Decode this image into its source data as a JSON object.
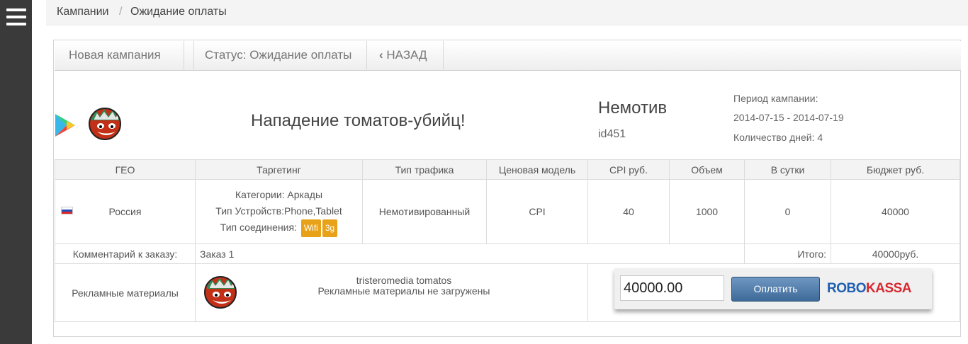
{
  "breadcrumb": {
    "root": "Кампании",
    "separator": "/",
    "current": "Ожидание оплаты"
  },
  "toolbar": {
    "new_campaign": "Новая кампания",
    "status_label": "Статус:",
    "status_value": "Ожидание оплаты",
    "back_icon": "‹",
    "back_label": "НАЗАД"
  },
  "campaign": {
    "title": "Нападение томатов-убийц!",
    "store_icon": "google-play-icon",
    "motivation": "Немотив",
    "id": "id451",
    "period_label": "Период кампании:",
    "period": "2014-07-15 - 2014-07-19",
    "days_label": "Количество дней:",
    "days": "4"
  },
  "table": {
    "headers": [
      "ГЕО",
      "Таргетинг",
      "Тип трафика",
      "Ценовая модель",
      "CPI руб.",
      "Объем",
      "В сутки",
      "Бюджет руб."
    ],
    "row": {
      "geo": "Россия",
      "targeting_categories": "Категории: Аркады",
      "targeting_devices": "Тип Устройств:Phone,Tablet",
      "targeting_connection": "Тип соединения:",
      "connection_badges": [
        "Wifi",
        "3g"
      ],
      "traffic_type": "Немотивированный",
      "price_model": "CPI",
      "cpi": "40",
      "volume": "1000",
      "per_day": "0",
      "budget": "40000"
    },
    "comment_label": "Комментарий к заказу:",
    "comment": "Заказ 1",
    "total_label": "Итого:",
    "total": "40000руб.",
    "materials_label": "Рекламные материалы",
    "materials_name": "tristeromedia tomatos",
    "materials_status": "Рекламные материалы не загружены"
  },
  "payment": {
    "amount": "40000.00",
    "pay_button": "Оплатить",
    "provider_part1": "ROBO",
    "provider_part2": "KASSA"
  },
  "colors": {
    "sidebar": "#3a3a3a",
    "badge": "#e8a21a",
    "robo_blue": "#1f5fb0",
    "kassa_red": "#d8262e",
    "button": "#4f7aa8"
  }
}
